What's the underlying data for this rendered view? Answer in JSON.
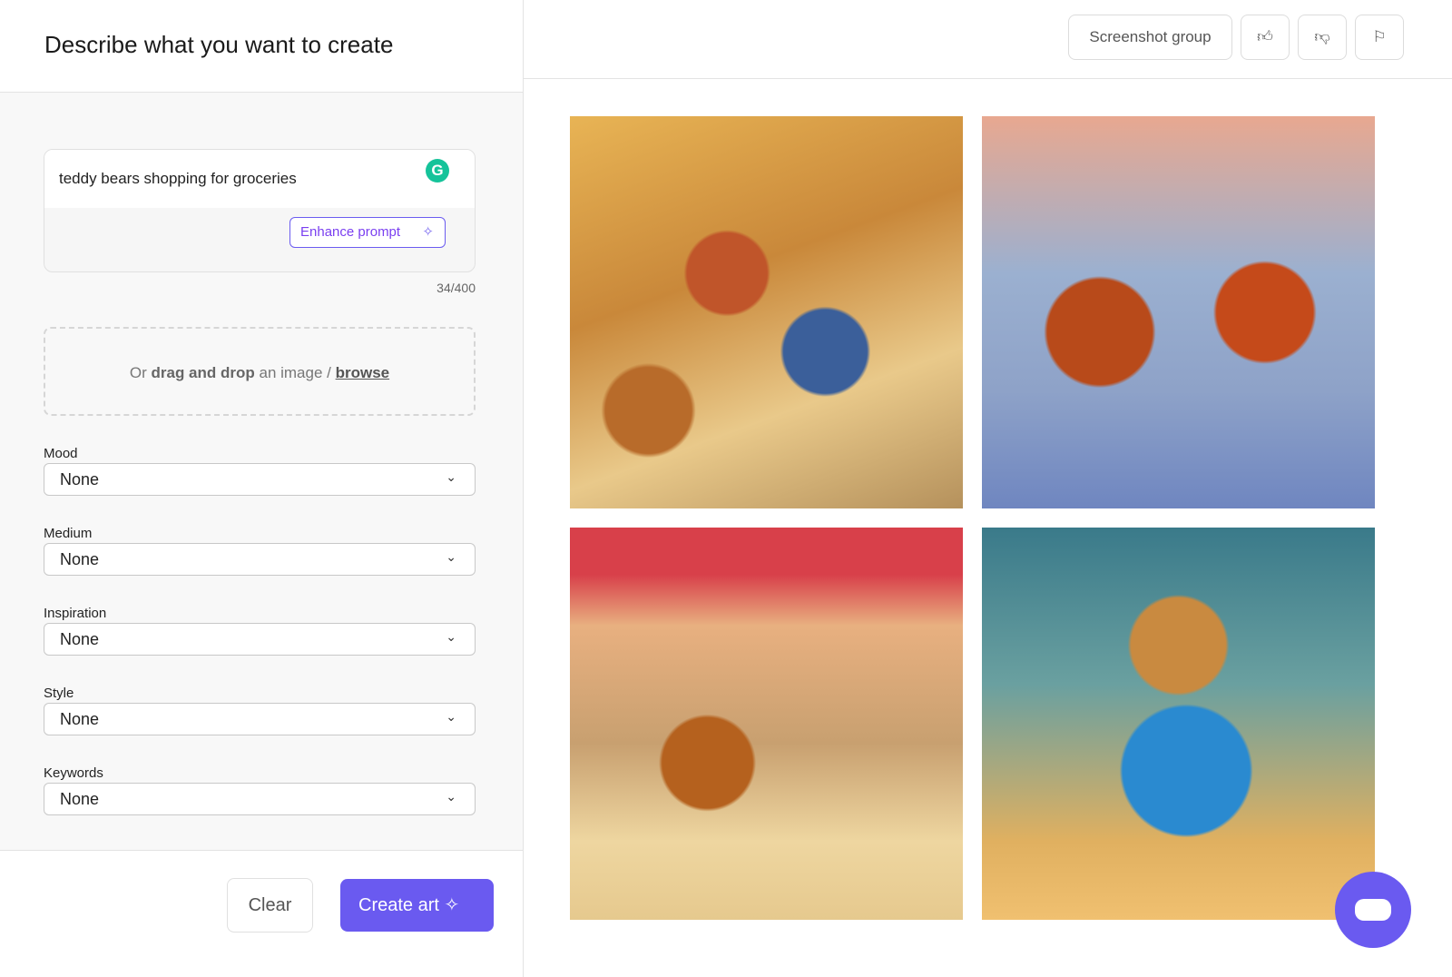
{
  "left": {
    "title": "Describe what you want to create",
    "prompt": {
      "value": "teddy bears shopping for groceries",
      "enhance_label": "Enhance prompt",
      "count": "34/400"
    },
    "drop": {
      "prefix": "Or ",
      "bold": "drag and drop",
      "middle": " an image / ",
      "link": "browse"
    },
    "fields": [
      {
        "label": "Mood",
        "value": "None"
      },
      {
        "label": "Medium",
        "value": "None"
      },
      {
        "label": "Inspiration",
        "value": "None"
      },
      {
        "label": "Style",
        "value": "None"
      },
      {
        "label": "Keywords",
        "value": "None"
      }
    ],
    "clear_label": "Clear",
    "create_label": "Create art"
  },
  "right": {
    "screenshot_label": "Screenshot group",
    "images": [
      "teddy bears in grocery aisle",
      "teddy bears with shopping carts at street market",
      "teddy bear with cart at market stall",
      "teddy bear in blue sweater holding bag"
    ]
  },
  "colors": {
    "accent": "#6a5af0",
    "grammarly": "#15c39a"
  }
}
